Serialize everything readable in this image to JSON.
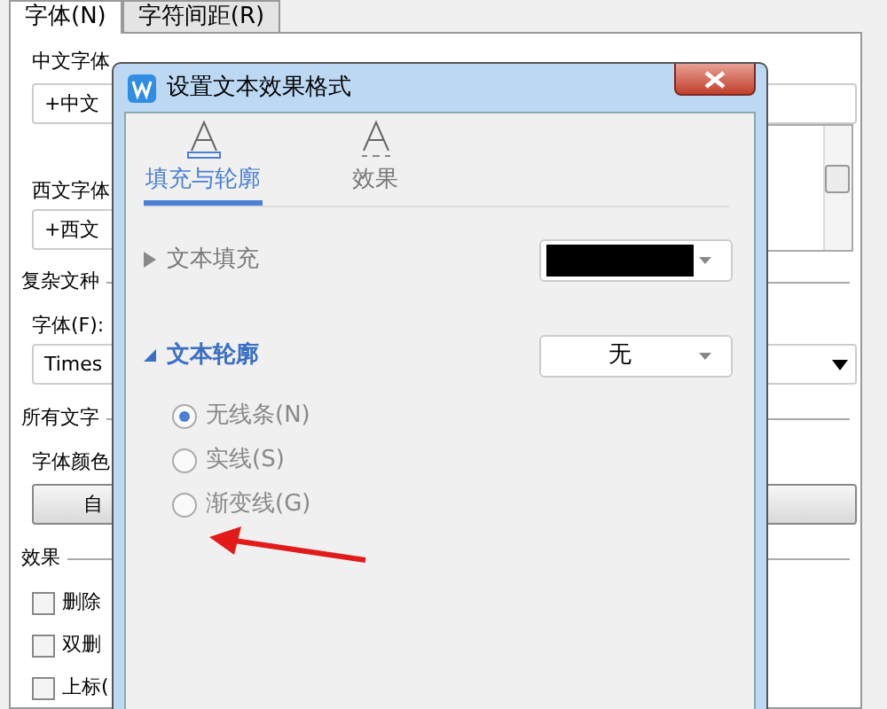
{
  "font_dialog": {
    "tabs": [
      {
        "label": "字体(N)",
        "selected": true
      },
      {
        "label": "字符间距(R)",
        "selected": false
      }
    ],
    "rows": [
      {
        "kind": "label",
        "text": "中文字体"
      },
      {
        "kind": "field",
        "value": "+中文"
      },
      {
        "kind": "label_with_list",
        "text": "西文字体"
      },
      {
        "kind": "field",
        "value": "+西文"
      },
      {
        "kind": "heading",
        "text": "复杂文种"
      },
      {
        "kind": "label",
        "text": "字体(F):"
      },
      {
        "kind": "combo",
        "value": "Times"
      },
      {
        "kind": "heading",
        "text": "所有文字"
      },
      {
        "kind": "label",
        "text": "字体颜色"
      },
      {
        "kind": "button",
        "text": "自"
      },
      {
        "kind": "heading",
        "text": "效果"
      },
      {
        "kind": "checkbox",
        "text": "删除",
        "checked": false
      },
      {
        "kind": "checkbox",
        "text": "双删",
        "checked": false
      },
      {
        "kind": "checkbox",
        "text": "上标(",
        "checked": false
      }
    ]
  },
  "effect_dialog": {
    "title": "设置文本效果格式",
    "tabs": [
      {
        "label": "填充与轮廓",
        "selected": true
      },
      {
        "label": "效果",
        "selected": false
      }
    ],
    "fill": {
      "label": "文本填充",
      "expanded": false,
      "color": "#000000"
    },
    "outline": {
      "label": "文本轮廓",
      "expanded": true,
      "value": "无",
      "options": [
        {
          "label": "无线条(N)",
          "selected": true
        },
        {
          "label": "实线(S)",
          "selected": false
        },
        {
          "label": "渐变线(G)",
          "selected": false
        }
      ]
    }
  }
}
